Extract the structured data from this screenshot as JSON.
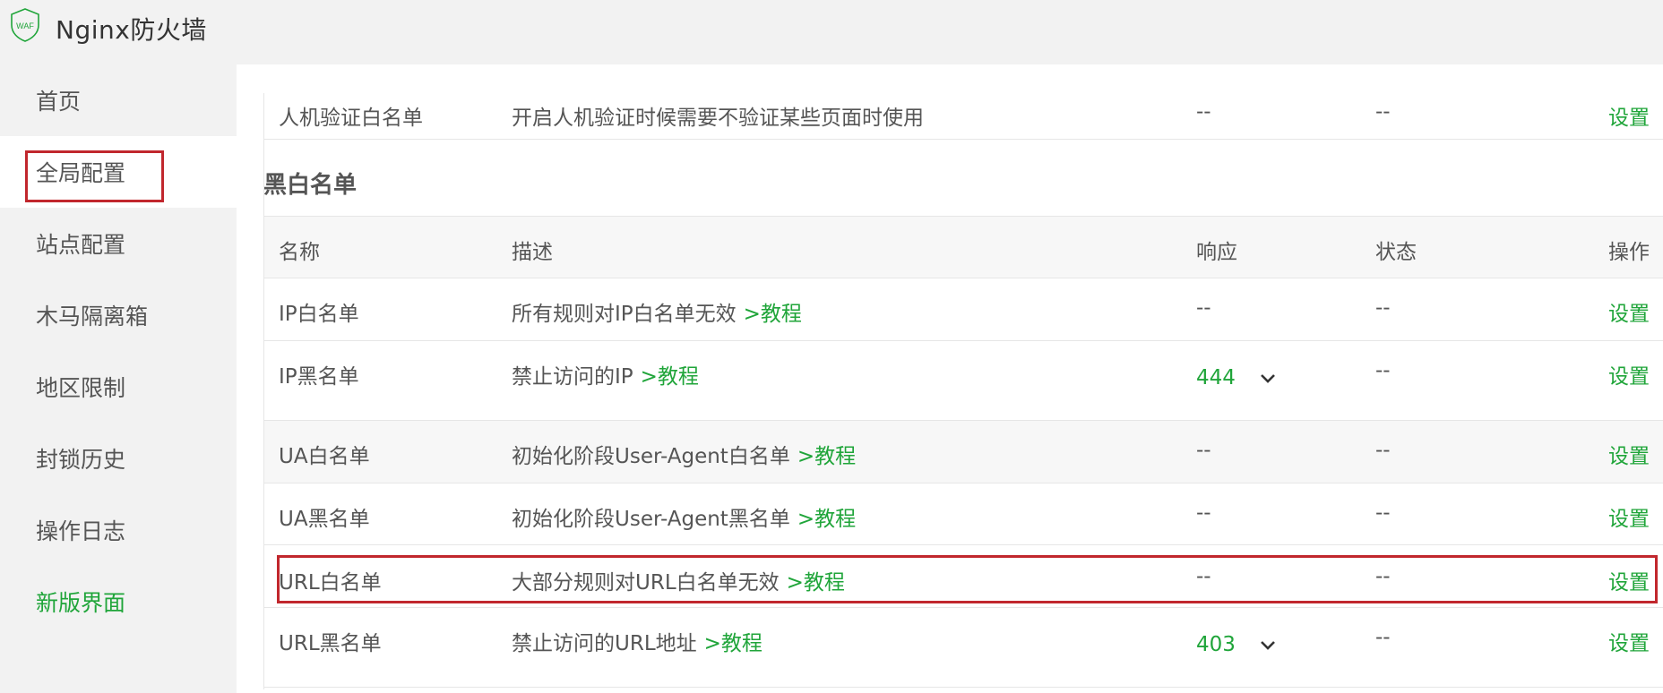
{
  "app": {
    "title": "Nginx防火墙",
    "logo_text": "WAF"
  },
  "sidebar": {
    "items": [
      {
        "label": "首页"
      },
      {
        "label": "全局配置"
      },
      {
        "label": "站点配置"
      },
      {
        "label": "木马隔离箱"
      },
      {
        "label": "地区限制"
      },
      {
        "label": "封锁历史"
      },
      {
        "label": "操作日志"
      },
      {
        "label": "新版界面"
      }
    ]
  },
  "top_row": {
    "name": "人机验证白名单",
    "desc": "开启人机验证时候需要不验证某些页面时使用",
    "resp": "--",
    "status": "--",
    "op": "设置"
  },
  "section": {
    "title": "黑白名单"
  },
  "table": {
    "headers": {
      "name": "名称",
      "desc": "描述",
      "resp": "响应",
      "status": "状态",
      "op": "操作"
    },
    "rows": [
      {
        "name": "IP白名单",
        "desc": "所有规则对IP白名单无效",
        "link": ">教程",
        "resp": "--",
        "status": "--",
        "op": "设置"
      },
      {
        "name": "IP黑名单",
        "desc": "禁止访问的IP",
        "link": ">教程",
        "resp": "444",
        "status": "--",
        "op": "设置"
      },
      {
        "name": "UA白名单",
        "desc": "初始化阶段User-Agent白名单",
        "link": ">教程",
        "resp": "--",
        "status": "--",
        "op": "设置"
      },
      {
        "name": "UA黑名单",
        "desc": "初始化阶段User-Agent黑名单",
        "link": ">教程",
        "resp": "--",
        "status": "--",
        "op": "设置"
      },
      {
        "name": "URL白名单",
        "desc": "大部分规则对URL白名单无效",
        "link": ">教程",
        "resp": "--",
        "status": "--",
        "op": "设置"
      },
      {
        "name": "URL黑名单",
        "desc": "禁止访问的URL地址",
        "link": ">教程",
        "resp": "403",
        "status": "--",
        "op": "设置"
      }
    ]
  },
  "colors": {
    "accent": "#20a53a",
    "highlight": "#c1272d",
    "sidebar_bg": "#f2f2f2"
  },
  "icons": {
    "logo": "waf-shield-icon",
    "dropdown": "chevron-down-icon"
  }
}
